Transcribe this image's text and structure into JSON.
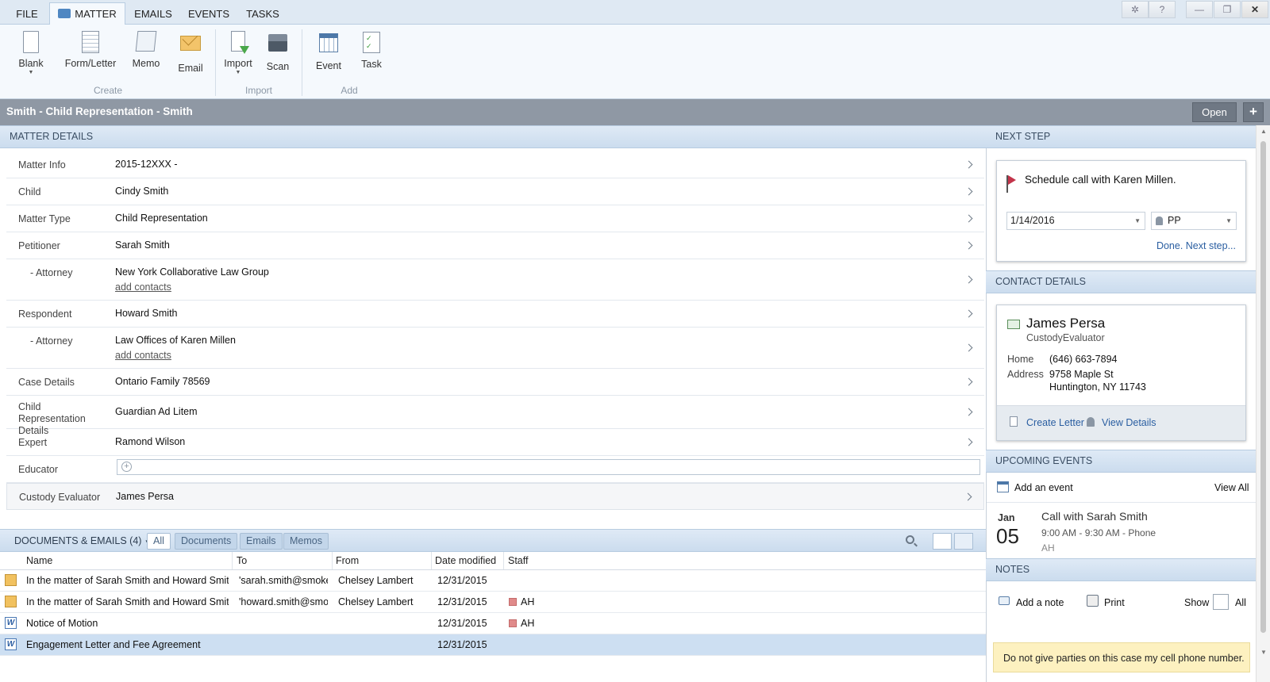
{
  "ribbon": {
    "tabs": [
      "FILE",
      "MATTER",
      "EMAILS",
      "EVENTS",
      "TASKS"
    ],
    "window_controls": {
      "settings": "✲",
      "help": "?",
      "minimize": "—",
      "restore": "❐",
      "close": "✕"
    },
    "create": {
      "blank": "Blank",
      "form_letter": "Form/Letter",
      "memo": "Memo",
      "email": "Email",
      "group": "Create"
    },
    "import": {
      "import": "Import",
      "scan": "Scan",
      "group": "Import"
    },
    "add": {
      "event": "Event",
      "task": "Task",
      "group": "Add"
    }
  },
  "header": {
    "title": "Smith - Child Representation - Smith",
    "open_label": "Open",
    "plus_label": "+"
  },
  "matter_details": {
    "section_title": "MATTER DETAILS",
    "rows": [
      {
        "label": "Matter Info",
        "value": "2015-12XXX -"
      },
      {
        "label": "Child",
        "value": "Cindy Smith"
      },
      {
        "label": "Matter Type",
        "value": "Child Representation"
      },
      {
        "label": "Petitioner",
        "value": "Sarah Smith"
      },
      {
        "label": "-  Attorney",
        "value": "New York Collaborative Law Group",
        "link": "add contacts"
      },
      {
        "label": "Respondent",
        "value": "Howard Smith"
      },
      {
        "label": "-  Attorney",
        "value": "Law Offices of Karen Millen",
        "link": "add contacts"
      },
      {
        "label": "Case Details",
        "value": "Ontario Family 78569"
      },
      {
        "label": "Child Representation Details",
        "value": "Guardian Ad Litem"
      },
      {
        "label": "Expert",
        "value": "Ramond Wilson"
      },
      {
        "label": "Educator",
        "value": ""
      },
      {
        "label": "Custody Evaluator",
        "value": "James Persa"
      }
    ]
  },
  "documents": {
    "title": "DOCUMENTS & EMAILS (4)",
    "caret": "▼",
    "filters": [
      "All",
      "Documents",
      "Emails",
      "Memos"
    ],
    "columns": [
      "Name",
      "To",
      "From",
      "Date modified",
      "Staff"
    ],
    "rows": [
      {
        "type": "email",
        "name": "In the matter of Sarah Smith and Howard Smit...",
        "to": "'sarah.smith@smoke",
        "from": "Chelsey Lambert",
        "date": "12/31/2015",
        "staff": ""
      },
      {
        "type": "email",
        "name": "In the matter of Sarah Smith and Howard Smit...",
        "to": "'howard.smith@smo",
        "from": "Chelsey Lambert",
        "date": "12/31/2015",
        "staff": "AH"
      },
      {
        "type": "word",
        "name": "Notice of Motion",
        "to": "",
        "from": "",
        "date": "12/31/2015",
        "staff": "AH"
      },
      {
        "type": "word",
        "name": "Engagement Letter and Fee Agreement",
        "to": "",
        "from": "",
        "date": "12/31/2015",
        "staff": ""
      }
    ]
  },
  "next_step": {
    "section_title": "NEXT STEP",
    "text": "Schedule call with Karen Millen.",
    "date": "1/14/2016",
    "assignee": "PP",
    "done_link": "Done. Next step..."
  },
  "contact": {
    "section_title": "CONTACT DETAILS",
    "name": "James Persa",
    "role": "CustodyEvaluator",
    "home_label": "Home",
    "home": "(646) 663-7894",
    "address_label": "Address",
    "address1": "9758 Maple St",
    "address2": "Huntington, NY 11743",
    "create_letter": "Create Letter",
    "view_details": "View Details"
  },
  "events": {
    "section_title": "UPCOMING EVENTS",
    "add_label": "Add an event",
    "view_all": "View All",
    "month": "Jan",
    "day": "05",
    "title": "Call with Sarah Smith",
    "time": "9:00 AM - 9:30 AM - Phone",
    "staff": "AH"
  },
  "notes": {
    "section_title": "NOTES",
    "add_label": "Add a note",
    "print_label": "Print",
    "show_label": "Show",
    "all_label": "All",
    "note_text": "Do not give parties on this case my cell phone number."
  },
  "colors": {
    "accent": "#2a5ea1",
    "header_bar": "#8f98a4",
    "section_bg": "#cbdcee",
    "selected_row": "#cddff2",
    "note_bg": "#fdf1c0"
  }
}
